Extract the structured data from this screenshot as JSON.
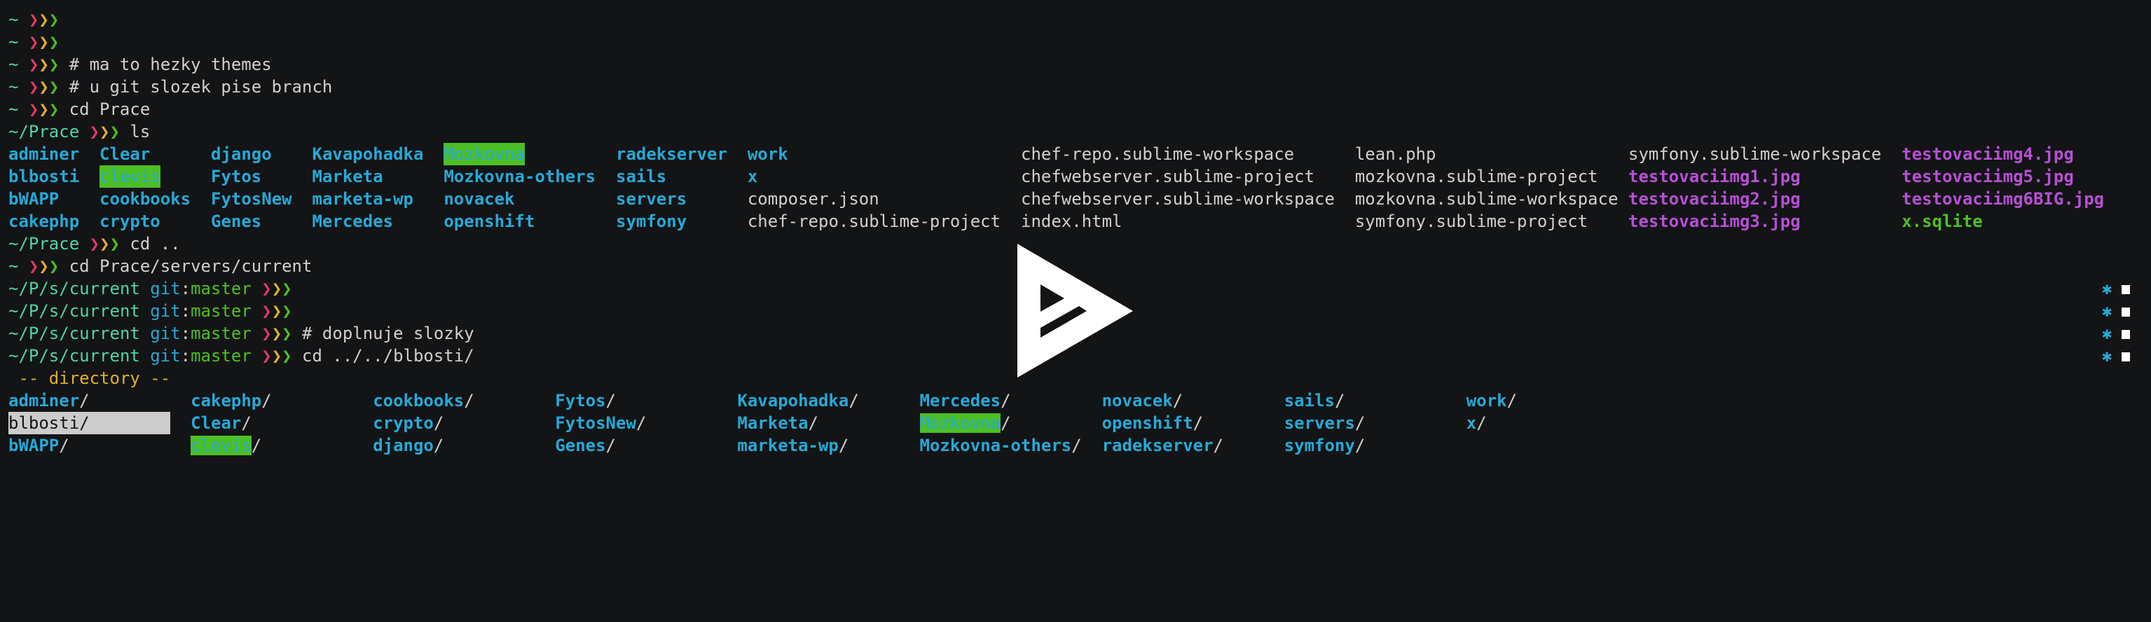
{
  "colors": {
    "background": "#131416",
    "directory": "#27a9d6",
    "path": "#4fd6a4",
    "branch": "#4ec021",
    "arrow1": "#e5376b",
    "arrow2": "#e0b030",
    "arrow3": "#4ec021",
    "image": "#b84fd6",
    "highlight_bg": "#4cbf25",
    "selection_bg": "#cccccc"
  },
  "prompt_arrow": "❯",
  "lines": [
    {
      "cwd": "~",
      "command": ""
    },
    {
      "cwd": "~",
      "command": ""
    },
    {
      "cwd": "~",
      "command": "# ma to hezky themes"
    },
    {
      "cwd": "~",
      "command": "# u git slozek pise branch"
    },
    {
      "cwd": "~",
      "command": "cd Prace"
    },
    {
      "cwd": "~/Prace",
      "command": "ls"
    },
    null,
    null,
    null,
    null,
    {
      "cwd": "~/Prace",
      "command": "cd .."
    },
    {
      "cwd": "~",
      "command": "cd Prace/servers/current"
    },
    {
      "cwd": "~/P/s/current",
      "git": "git",
      "branch": "master",
      "command": ""
    },
    {
      "cwd": "~/P/s/current",
      "git": "git",
      "branch": "master",
      "command": ""
    },
    {
      "cwd": "~/P/s/current",
      "git": "git",
      "branch": "master",
      "command": "# doplnuje slozky"
    },
    {
      "cwd": "~/P/s/current",
      "git": "git",
      "branch": "master",
      "command": "cd ../../blbosti/"
    }
  ],
  "ls_output": [
    [
      {
        "n": "adminer",
        "t": "dir"
      },
      {
        "n": "blbosti",
        "t": "dir"
      },
      {
        "n": "bWAPP",
        "t": "dir"
      },
      {
        "n": "cakephp",
        "t": "dir"
      }
    ],
    [
      {
        "n": "Clear",
        "t": "dir"
      },
      {
        "n": "clevis",
        "t": "hl"
      },
      {
        "n": "cookbooks",
        "t": "dir"
      },
      {
        "n": "crypto",
        "t": "dir"
      }
    ],
    [
      {
        "n": "django",
        "t": "dir"
      },
      {
        "n": "Fytos",
        "t": "dir"
      },
      {
        "n": "FytosNew",
        "t": "dir"
      },
      {
        "n": "Genes",
        "t": "dir"
      }
    ],
    [
      {
        "n": "Kavapohadka",
        "t": "dir"
      },
      {
        "n": "Marketa",
        "t": "dir"
      },
      {
        "n": "marketa-wp",
        "t": "dir"
      },
      {
        "n": "Mercedes",
        "t": "dir"
      }
    ],
    [
      {
        "n": "Mozkovna",
        "t": "hl"
      },
      {
        "n": "Mozkovna-others",
        "t": "dir"
      },
      {
        "n": "novacek",
        "t": "dir"
      },
      {
        "n": "openshift",
        "t": "dir"
      }
    ],
    [
      {
        "n": "radekserver",
        "t": "dir"
      },
      {
        "n": "sails",
        "t": "dir"
      },
      {
        "n": "servers",
        "t": "dir"
      },
      {
        "n": "symfony",
        "t": "dir"
      }
    ],
    [
      {
        "n": "work",
        "t": "dir"
      },
      {
        "n": "x",
        "t": "dir"
      },
      {
        "n": "composer.json",
        "t": "file"
      },
      {
        "n": "chef-repo.sublime-project",
        "t": "file"
      }
    ],
    [
      {
        "n": "chef-repo.sublime-workspace",
        "t": "file"
      },
      {
        "n": "chefwebserver.sublime-project",
        "t": "file"
      },
      {
        "n": "chefwebserver.sublime-workspace",
        "t": "file"
      },
      {
        "n": "index.html",
        "t": "file"
      }
    ],
    [
      {
        "n": "lean.php",
        "t": "file"
      },
      {
        "n": "mozkovna.sublime-project",
        "t": "file"
      },
      {
        "n": "mozkovna.sublime-workspace",
        "t": "file"
      },
      {
        "n": "symfony.sublime-project",
        "t": "file"
      }
    ],
    [
      {
        "n": "symfony.sublime-workspace",
        "t": "file"
      },
      {
        "n": "testovaciimg1.jpg",
        "t": "image"
      },
      {
        "n": "testovaciimg2.jpg",
        "t": "image"
      },
      {
        "n": "testovaciimg3.jpg",
        "t": "image"
      }
    ],
    [
      {
        "n": "testovaciimg4.jpg",
        "t": "image"
      },
      {
        "n": "testovaciimg5.jpg",
        "t": "image"
      },
      {
        "n": "testovaciimg6BIG.jpg",
        "t": "image"
      },
      {
        "n": "x.sqlite",
        "t": "exec"
      }
    ]
  ],
  "completion": {
    "header": " -- directory --",
    "slash": "/",
    "columns": [
      [
        {
          "n": "adminer"
        },
        {
          "n": "blbosti",
          "selected": true
        },
        {
          "n": "bWAPP"
        }
      ],
      [
        {
          "n": "cakephp"
        },
        {
          "n": "Clear"
        },
        {
          "n": "clevis",
          "hl": true
        }
      ],
      [
        {
          "n": "cookbooks"
        },
        {
          "n": "crypto"
        },
        {
          "n": "django"
        }
      ],
      [
        {
          "n": "Fytos"
        },
        {
          "n": "FytosNew"
        },
        {
          "n": "Genes"
        }
      ],
      [
        {
          "n": "Kavapohadka"
        },
        {
          "n": "Marketa"
        },
        {
          "n": "marketa-wp"
        }
      ],
      [
        {
          "n": "Mercedes"
        },
        {
          "n": "Mozkovna",
          "hl": true
        },
        {
          "n": "Mozkovna-others"
        }
      ],
      [
        {
          "n": "novacek"
        },
        {
          "n": "openshift"
        },
        {
          "n": "radekserver"
        }
      ],
      [
        {
          "n": "sails"
        },
        {
          "n": "servers"
        },
        {
          "n": "symfony"
        }
      ],
      [
        {
          "n": "work"
        },
        {
          "n": "x"
        }
      ]
    ]
  },
  "right_markers": {
    "count": 4,
    "star": "✱"
  },
  "logo_icon": "play-triangle-logo-icon"
}
